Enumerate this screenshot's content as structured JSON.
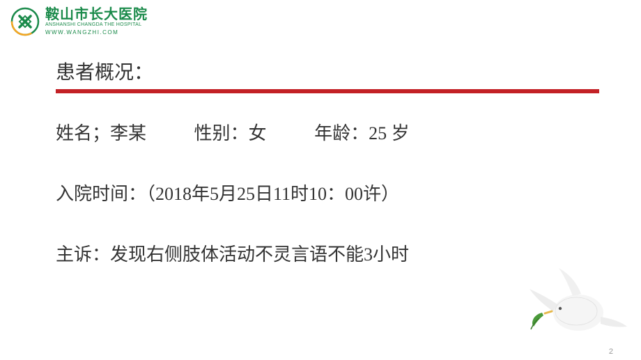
{
  "logo": {
    "hospital_cn": "鞍山市长大医院",
    "hospital_en": "ANSHANSHI CHANGDA THE HOSPITAL",
    "url": "WWW.WANGZHI.COM"
  },
  "section_title": "患者概况：",
  "patient": {
    "name_label": "姓名；",
    "name_value": "李某",
    "sex_label": "性别：",
    "sex_value": "女",
    "age_label": "年龄：",
    "age_value": "25 岁"
  },
  "admission": {
    "label": "入院时间：",
    "value": "（2018年5月25日11时10：00许）"
  },
  "complaint": {
    "label": "主诉：",
    "value": "发现右侧肢体活动不灵言语不能3小时"
  },
  "page_number": "2",
  "colors": {
    "brand_green": "#1a8a4a",
    "accent_red": "#c32126"
  }
}
